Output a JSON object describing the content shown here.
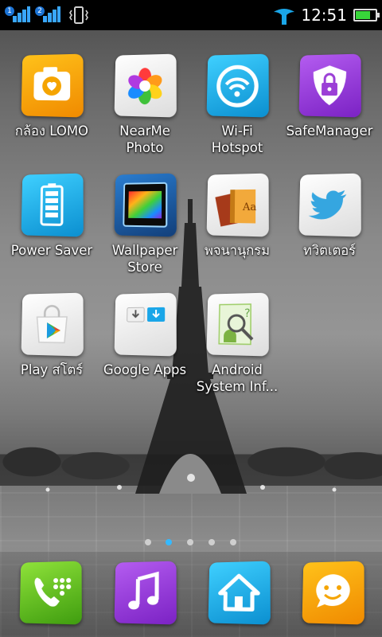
{
  "status_bar": {
    "sim1": "1",
    "sim2": "2",
    "time": "12:51",
    "battery_level": 0.75,
    "carrier_color": "#1aa6e8"
  },
  "apps": [
    {
      "label": "กล้อง LOMO",
      "icon": "camera-icon",
      "color": "#f5a400"
    },
    {
      "label": "NearMe\nPhoto",
      "icon": "flower-icon",
      "color": "#ffffff"
    },
    {
      "label": "Wi-Fi\nHotspot",
      "icon": "wifi-icon",
      "color": "#12a9e0"
    },
    {
      "label": "SafeManager",
      "icon": "lock-shield-icon",
      "color": "#9b3fd6"
    },
    {
      "label": "Power Saver",
      "icon": "battery-icon",
      "color": "#12a9e0"
    },
    {
      "label": "Wallpaper\nStore",
      "icon": "wallpaper-icon",
      "color": "#2166a6"
    },
    {
      "label": "พจนานุกรม",
      "icon": "dictionary-icon",
      "color": "#ffffff"
    },
    {
      "label": "ทวิตเตอร์",
      "icon": "twitter-bird-icon",
      "color": "#ffffff"
    },
    {
      "label": "Play สโตร์",
      "icon": "play-store-icon",
      "color": "#ffffff"
    },
    {
      "label": "Google Apps",
      "icon": "google-apps-folder-icon",
      "color": "#ffffff"
    },
    {
      "label": "Android\nSystem Inf...",
      "icon": "android-magnifier-icon",
      "color": "#ffffff"
    }
  ],
  "page_indicator": {
    "count": 5,
    "active": 1
  },
  "dock": [
    {
      "name": "phone",
      "icon": "phone-dialer-icon",
      "color": "#5ac21c"
    },
    {
      "name": "music",
      "icon": "music-note-icon",
      "color": "#8e3bd8"
    },
    {
      "name": "home",
      "icon": "home-icon",
      "color": "#12a9e0"
    },
    {
      "name": "messaging",
      "icon": "smiley-message-icon",
      "color": "#f5a400"
    }
  ]
}
